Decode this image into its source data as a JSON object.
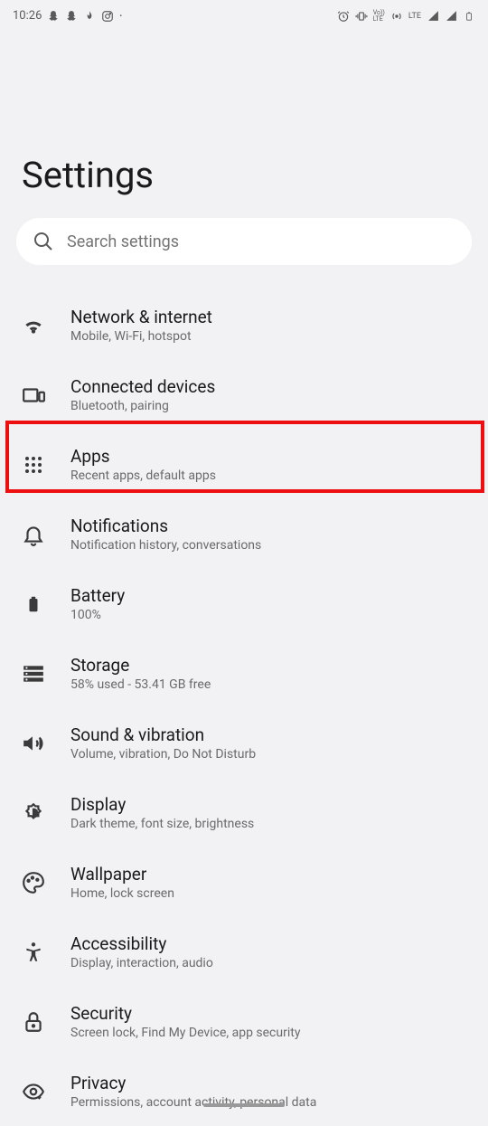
{
  "status_bar": {
    "time": "10:26",
    "lte_label": "LTE",
    "vo_label": "Vo))\nLTE"
  },
  "page": {
    "title": "Settings"
  },
  "search": {
    "placeholder": "Search settings"
  },
  "items": [
    {
      "title": "Network & internet",
      "subtitle": "Mobile, Wi-Fi, hotspot"
    },
    {
      "title": "Connected devices",
      "subtitle": "Bluetooth, pairing"
    },
    {
      "title": "Apps",
      "subtitle": "Recent apps, default apps"
    },
    {
      "title": "Notifications",
      "subtitle": "Notification history, conversations"
    },
    {
      "title": "Battery",
      "subtitle": "100%"
    },
    {
      "title": "Storage",
      "subtitle": "58% used - 53.41 GB free"
    },
    {
      "title": "Sound & vibration",
      "subtitle": "Volume, vibration, Do Not Disturb"
    },
    {
      "title": "Display",
      "subtitle": "Dark theme, font size, brightness"
    },
    {
      "title": "Wallpaper",
      "subtitle": "Home, lock screen"
    },
    {
      "title": "Accessibility",
      "subtitle": "Display, interaction, audio"
    },
    {
      "title": "Security",
      "subtitle": "Screen lock, Find My Device, app security"
    },
    {
      "title": "Privacy",
      "subtitle": "Permissions, account activity, personal data"
    }
  ]
}
